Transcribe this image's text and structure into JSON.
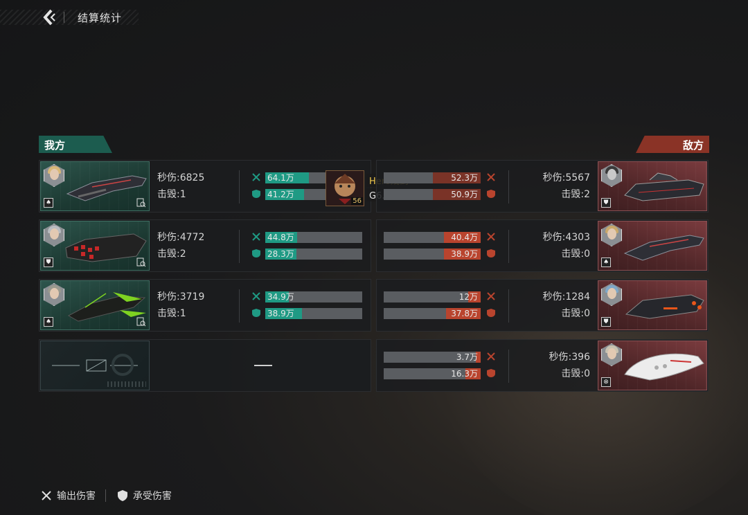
{
  "header": {
    "title": "结算统计"
  },
  "teams": {
    "ally_label": "我方",
    "enemy_label": "敌方"
  },
  "mvp": {
    "name": "Hero残剑",
    "guild": "G6.处女座",
    "level": "56"
  },
  "ally": [
    {
      "dps_label": "秒伤:6825",
      "kills_label": "击毁:1",
      "dmg_out": "64.1万",
      "dmg_in": "41.2万",
      "out_fill": 0.45,
      "in_fill": 0.4,
      "class_icon": "assault-class-icon"
    },
    {
      "dps_label": "秒伤:4772",
      "kills_label": "击毁:2",
      "dmg_out": "44.8万",
      "dmg_in": "28.3万",
      "out_fill": 0.33,
      "in_fill": 0.32,
      "class_icon": "shield-class-icon"
    },
    {
      "dps_label": "秒伤:3719",
      "kills_label": "击毁:1",
      "dmg_out": "34.9万",
      "dmg_in": "38.9万",
      "out_fill": 0.24,
      "in_fill": 0.38,
      "class_icon": "assault-class-icon"
    }
  ],
  "ally_empty": {
    "placeholder": "—"
  },
  "enemy": [
    {
      "dps_label": "秒伤:5567",
      "kills_label": "击毁:2",
      "dmg_out": "52.3万",
      "dmg_in": "50.9万",
      "out_fill": 0.49,
      "in_fill": 0.49,
      "class_icon": "shield-class-icon"
    },
    {
      "dps_label": "秒伤:4303",
      "kills_label": "击毁:0",
      "dmg_out": "40.4万",
      "dmg_in": "38.9万",
      "out_fill": 0.38,
      "in_fill": 0.38,
      "class_icon": "assault-class-icon"
    },
    {
      "dps_label": "秒伤:1284",
      "kills_label": "击毁:0",
      "dmg_out": "12万",
      "dmg_in": "37.8万",
      "out_fill": 0.13,
      "in_fill": 0.36,
      "class_icon": "shield-class-icon"
    },
    {
      "dps_label": "秒伤:396",
      "kills_label": "击毁:0",
      "dmg_out": "3.7万",
      "dmg_in": "16.3万",
      "out_fill": 0.05,
      "in_fill": 0.16,
      "class_icon": "support-class-icon"
    }
  ],
  "legend": {
    "dealt": "输出伤害",
    "taken": "承受伤害"
  },
  "colors": {
    "ally_accent": "#1f9a84",
    "enemy_accent": "#b9442e"
  }
}
